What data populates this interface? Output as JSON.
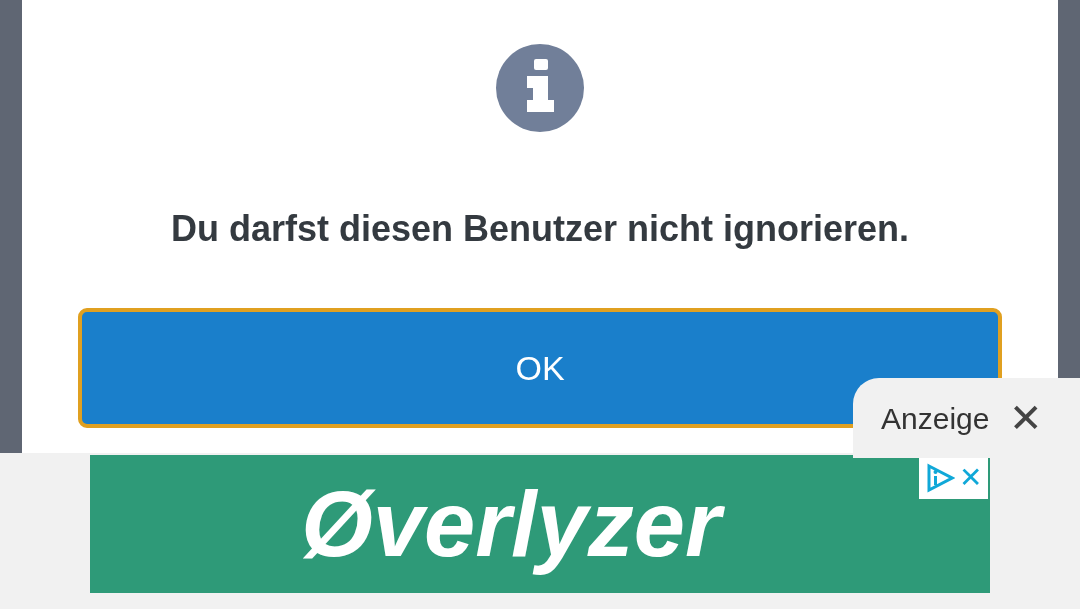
{
  "dialog": {
    "message": "Du darfst diesen Benutzer nicht ignorieren.",
    "button": {
      "label": "OK",
      "focused": true
    }
  },
  "ad": {
    "label": "Anzeige",
    "close": "✕",
    "banner_text": "Øverlyzer",
    "banner_close": "✕"
  }
}
